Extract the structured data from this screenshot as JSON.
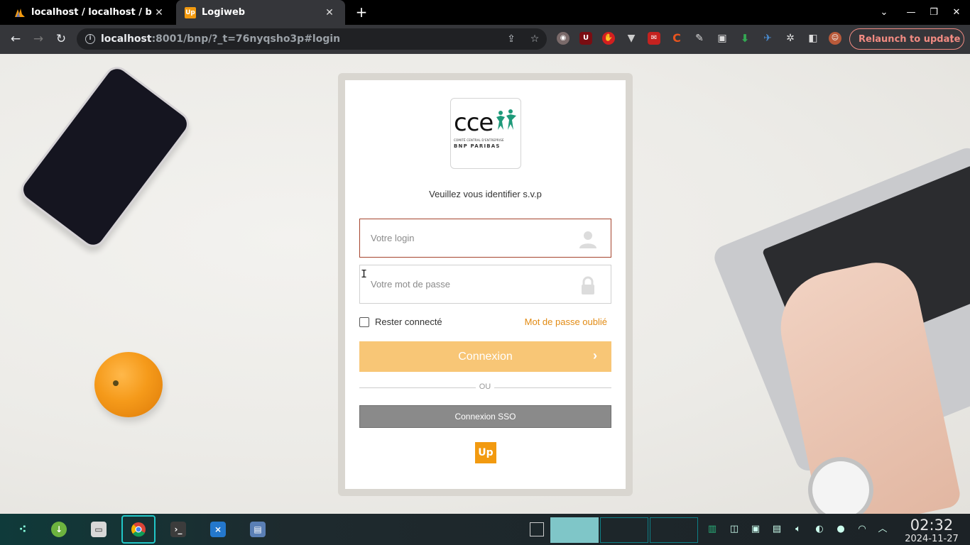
{
  "browser": {
    "tabs": [
      {
        "title": "localhost / localhost / bnp",
        "favicon": "phpmyadmin-icon"
      },
      {
        "title": "Logiweb",
        "favicon": "up-icon",
        "favicon_text": "Up"
      }
    ],
    "url_host": "localhost",
    "url_rest": ":8001/bnp/?_t=76nyqsho3p#login",
    "relaunch_label": "Relaunch to update",
    "accent_color": "#f28b82"
  },
  "login": {
    "logo": {
      "main": "cce",
      "line1": "COMITÉ CENTRAL D'ENTREPRISE",
      "line2": "BNP PARIBAS"
    },
    "prompt": "Veuillez vous identifier s.v.p",
    "login_placeholder": "Votre login",
    "password_placeholder": "Votre mot de passe",
    "remember_label": "Rester connecté",
    "forgot_label": "Mot de passe oublié",
    "connect_label": "Connexion",
    "or_label": "OU",
    "sso_label": "Connexion SSO",
    "footer_logo": "Up",
    "colors": {
      "accent": "#e28b14",
      "connect_bg": "#f8c676",
      "sso_bg": "#8a8a8a",
      "active_border": "#a5442d"
    }
  },
  "taskbar": {
    "time": "02:32",
    "date": "2024-11-27"
  }
}
